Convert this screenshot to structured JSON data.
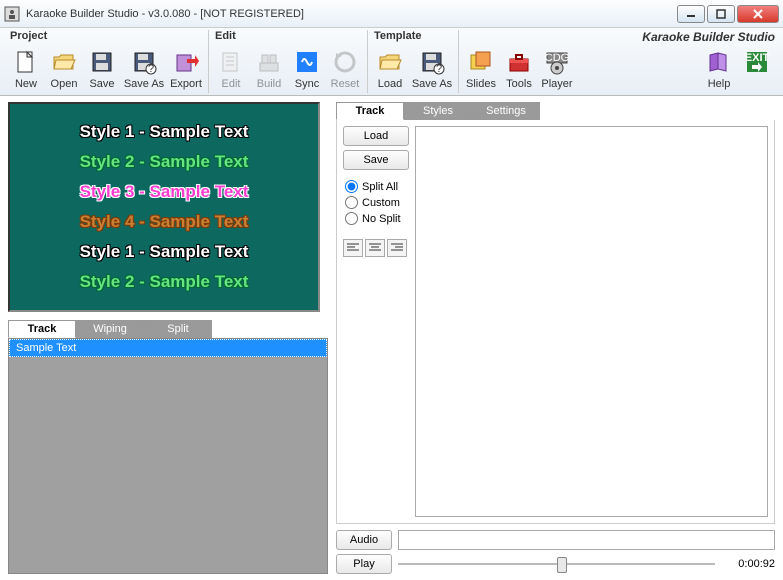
{
  "title": "Karaoke Builder Studio - v3.0.080 - [NOT REGISTERED]",
  "brand": "Karaoke Builder Studio",
  "groups": {
    "project": {
      "label": "Project",
      "new": "New",
      "open": "Open",
      "save": "Save",
      "saveas": "Save As",
      "export": "Export"
    },
    "edit": {
      "label": "Edit",
      "edit": "Edit",
      "build": "Build",
      "sync": "Sync",
      "reset": "Reset"
    },
    "template": {
      "label": "Template",
      "load": "Load",
      "saveas": "Save As"
    },
    "misc": {
      "slides": "Slides",
      "tools": "Tools",
      "player": "Player",
      "help": "Help",
      "exit": "EXIT"
    }
  },
  "preview": [
    {
      "text": "Style 1 - Sample Text",
      "cls": "s1"
    },
    {
      "text": "Style 2 - Sample Text",
      "cls": "s2"
    },
    {
      "text": "Style 3 - Sample Text",
      "cls": "s3"
    },
    {
      "text": "Style 4 - Sample Text",
      "cls": "s4"
    },
    {
      "text": "Style 1 - Sample Text",
      "cls": "s1"
    },
    {
      "text": "Style 2 - Sample Text",
      "cls": "s2"
    }
  ],
  "tabs1": {
    "track": "Track",
    "wiping": "Wiping",
    "split": "Split"
  },
  "list": {
    "item0": "Sample Text"
  },
  "tabs2": {
    "track": "Track",
    "styles": "Styles",
    "settings": "Settings"
  },
  "trackctrl": {
    "load": "Load",
    "save": "Save",
    "splitall": "Split All",
    "custom": "Custom",
    "nosplit": "No Split"
  },
  "bottom": {
    "audio": "Audio",
    "play": "Play",
    "time": "0:00:92"
  }
}
